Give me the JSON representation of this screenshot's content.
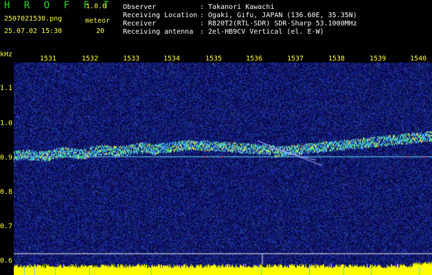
{
  "app": {
    "title": "H R O F F T",
    "version": "1.0.0",
    "filename": "2507021530.png",
    "datetime": "25.07.02 15:30",
    "meteor_label": "meteor",
    "meteor_count": "20"
  },
  "info": [
    {
      "label": "Observer",
      "value": ": Takanori Kawachi"
    },
    {
      "label": "Receiving Location",
      "value": ": Ogaki, Gifu, JAPAN (136.60E, 35.35N)"
    },
    {
      "label": "Receiver",
      "value": ": R820T2(RTL-SDR) SDR-Sharp 53.1000MHz"
    },
    {
      "label": "Receiving antenna",
      "value": ": 2el-HB9CV Vertical (el. E-W)"
    }
  ],
  "axis": {
    "y_unit": "kHz",
    "y_ticks": [
      "1.1",
      "1.0",
      "0.9",
      "0.8",
      "0.7",
      "0.6"
    ],
    "x_ticks": [
      "1531",
      "1532",
      "1533",
      "1534",
      "1535",
      "1536",
      "1537",
      "1538",
      "1539",
      "1540"
    ]
  },
  "colors": {
    "header_green": "#2fd82f",
    "header_yellow": "#ffff3a",
    "background": "#06064a",
    "signal_line": "#6fe8ff",
    "bottom_bar": "#ffff00"
  }
}
